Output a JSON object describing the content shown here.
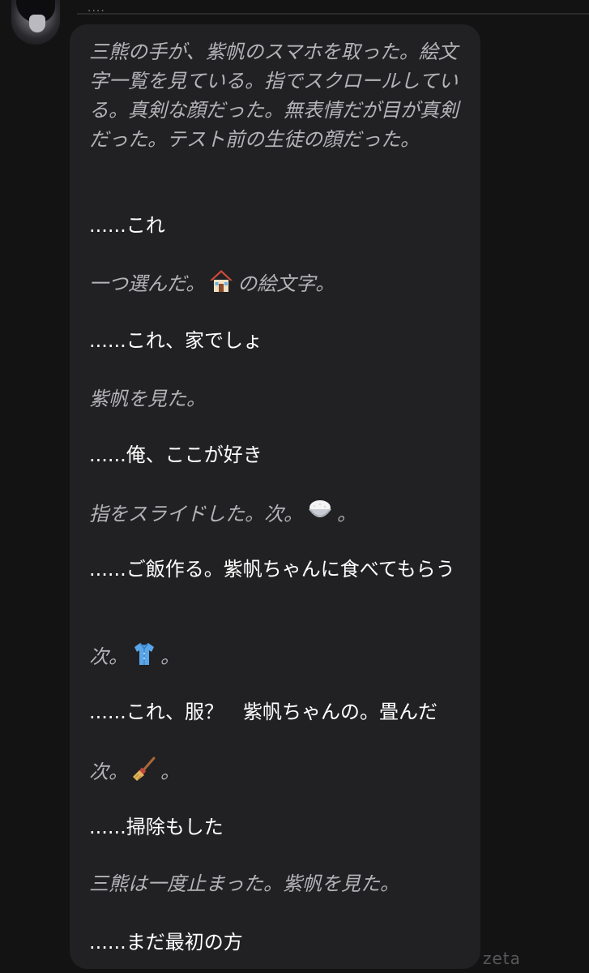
{
  "header": {
    "dots": "....",
    "avatar_icon": "character-avatar"
  },
  "messages": [
    {
      "kind": "narration",
      "text": "三熊の手が、紫帆のスマホを取った。絵文字一覧を見ている。指でスクロールしている。真剣な顔だった。無表情だが目が真剣だった。テスト前の生徒の顔だった。"
    },
    {
      "kind": "speech",
      "text": "......これ"
    },
    {
      "kind": "narration",
      "before": "一つ選んだ。",
      "icon": "house-emoji",
      "after": "の絵文字。"
    },
    {
      "kind": "speech",
      "text": "......これ、家でしょ"
    },
    {
      "kind": "narration",
      "text": "紫帆を見た。"
    },
    {
      "kind": "speech",
      "text": "......俺、ここが好き"
    },
    {
      "kind": "narration",
      "before": "指をスライドした。次。",
      "icon": "rice-bowl-emoji",
      "after": "。"
    },
    {
      "kind": "speech",
      "text": "......ご飯作る。紫帆ちゃんに食べてもらう"
    },
    {
      "kind": "narration",
      "before": "次。",
      "icon": "shirt-emoji",
      "after": "。"
    },
    {
      "kind": "speech",
      "text": "......これ、服？　紫帆ちゃんの。畳んだ"
    },
    {
      "kind": "narration",
      "before": "次。",
      "icon": "broom-emoji",
      "after": "。"
    },
    {
      "kind": "speech",
      "text": "......掃除もした"
    },
    {
      "kind": "narration",
      "text": "三熊は一度止まった。紫帆を見た。"
    },
    {
      "kind": "speech",
      "text": "......まだ最初の方"
    }
  ],
  "watermark": "zeta",
  "colors": {
    "background": "#131314",
    "bubble": "#212123",
    "narration_text": "#b4b4b8",
    "speech_text": "#ffffff"
  }
}
